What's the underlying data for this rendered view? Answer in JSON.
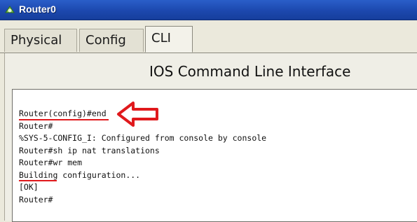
{
  "window": {
    "title": "Router0",
    "icon": "router-app-icon"
  },
  "tabs": [
    {
      "label": "Physical",
      "active": false
    },
    {
      "label": "Config",
      "active": false
    },
    {
      "label": "CLI",
      "active": true
    }
  ],
  "cli": {
    "heading": "IOS Command Line Interface",
    "lines": [
      "Router(config)#end",
      "Router#",
      "%SYS-5-CONFIG_I: Configured from console by console",
      "Router#sh ip nat translations",
      "Router#wr mem",
      "Building configuration...",
      "[OK]",
      "Router#"
    ]
  },
  "annotations": {
    "color": "#e0191c",
    "arrow": "left-arrow-outline"
  }
}
